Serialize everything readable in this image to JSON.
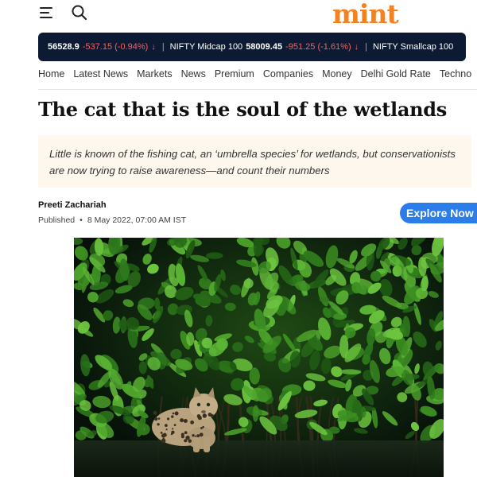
{
  "header": {
    "logo": "mint",
    "menu_icon": "hamburger-menu-icon",
    "search_icon": "search-icon",
    "brand_color": "#f5821f"
  },
  "ticker": {
    "items": [
      {
        "name": "",
        "value": " 56528.9",
        "change": "-537.15 (-0.94%)"
      },
      {
        "name": "NIFTY Midcap 100",
        "value": "58009.45",
        "change": "-951.25 (-1.61%)"
      },
      {
        "name": "NIFTY Smallcap 100",
        "value": "",
        "change": ""
      }
    ],
    "down_color": "#ff5d5d"
  },
  "nav": {
    "items": [
      "Home",
      "Latest News",
      "Markets",
      "News",
      "Premium",
      "Companies",
      "Money",
      "Delhi Gold Rate",
      "Techno"
    ]
  },
  "article": {
    "headline": "The cat that is the soul of the wetlands",
    "summary": "Little is known of the fishing cat, an ‘umbrella species’ for wetlands, but conservationists are now trying to raise awareness—and count their numbers",
    "author": "Preeti Zachariah",
    "published_label": "Published",
    "published_date": "8 May 2022, 07:00 AM IST"
  },
  "explore_button": {
    "label": "Explore Now"
  },
  "image": {
    "subject": "fishing cat in mangroves"
  }
}
